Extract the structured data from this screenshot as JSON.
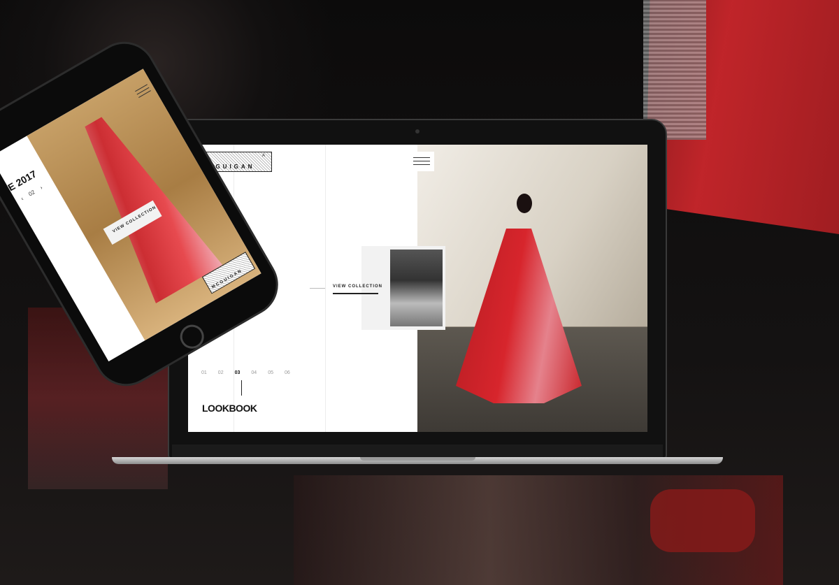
{
  "laptop": {
    "logo": {
      "letters_top": [
        "K",
        "A"
      ],
      "wordmark": "MCGUIGAN"
    },
    "menu_icon": "hamburger-menu-icon",
    "view_collection": "VIEW COLLECTION",
    "pager": [
      "01",
      "02",
      "03",
      "04",
      "05",
      "06"
    ],
    "active_page": "03",
    "section_title": "LOOKBOOK"
  },
  "phone": {
    "title": "E 2017",
    "pager": {
      "current": "02"
    },
    "view_collection": "VIEW COLLECTION",
    "logo_wordmark": "MCGUIGAN",
    "menu_icon": "hamburger-menu-icon"
  },
  "colors": {
    "background": "#0d0c0c",
    "accent_red": "#d7252c",
    "accent_pink": "#e5828c"
  }
}
